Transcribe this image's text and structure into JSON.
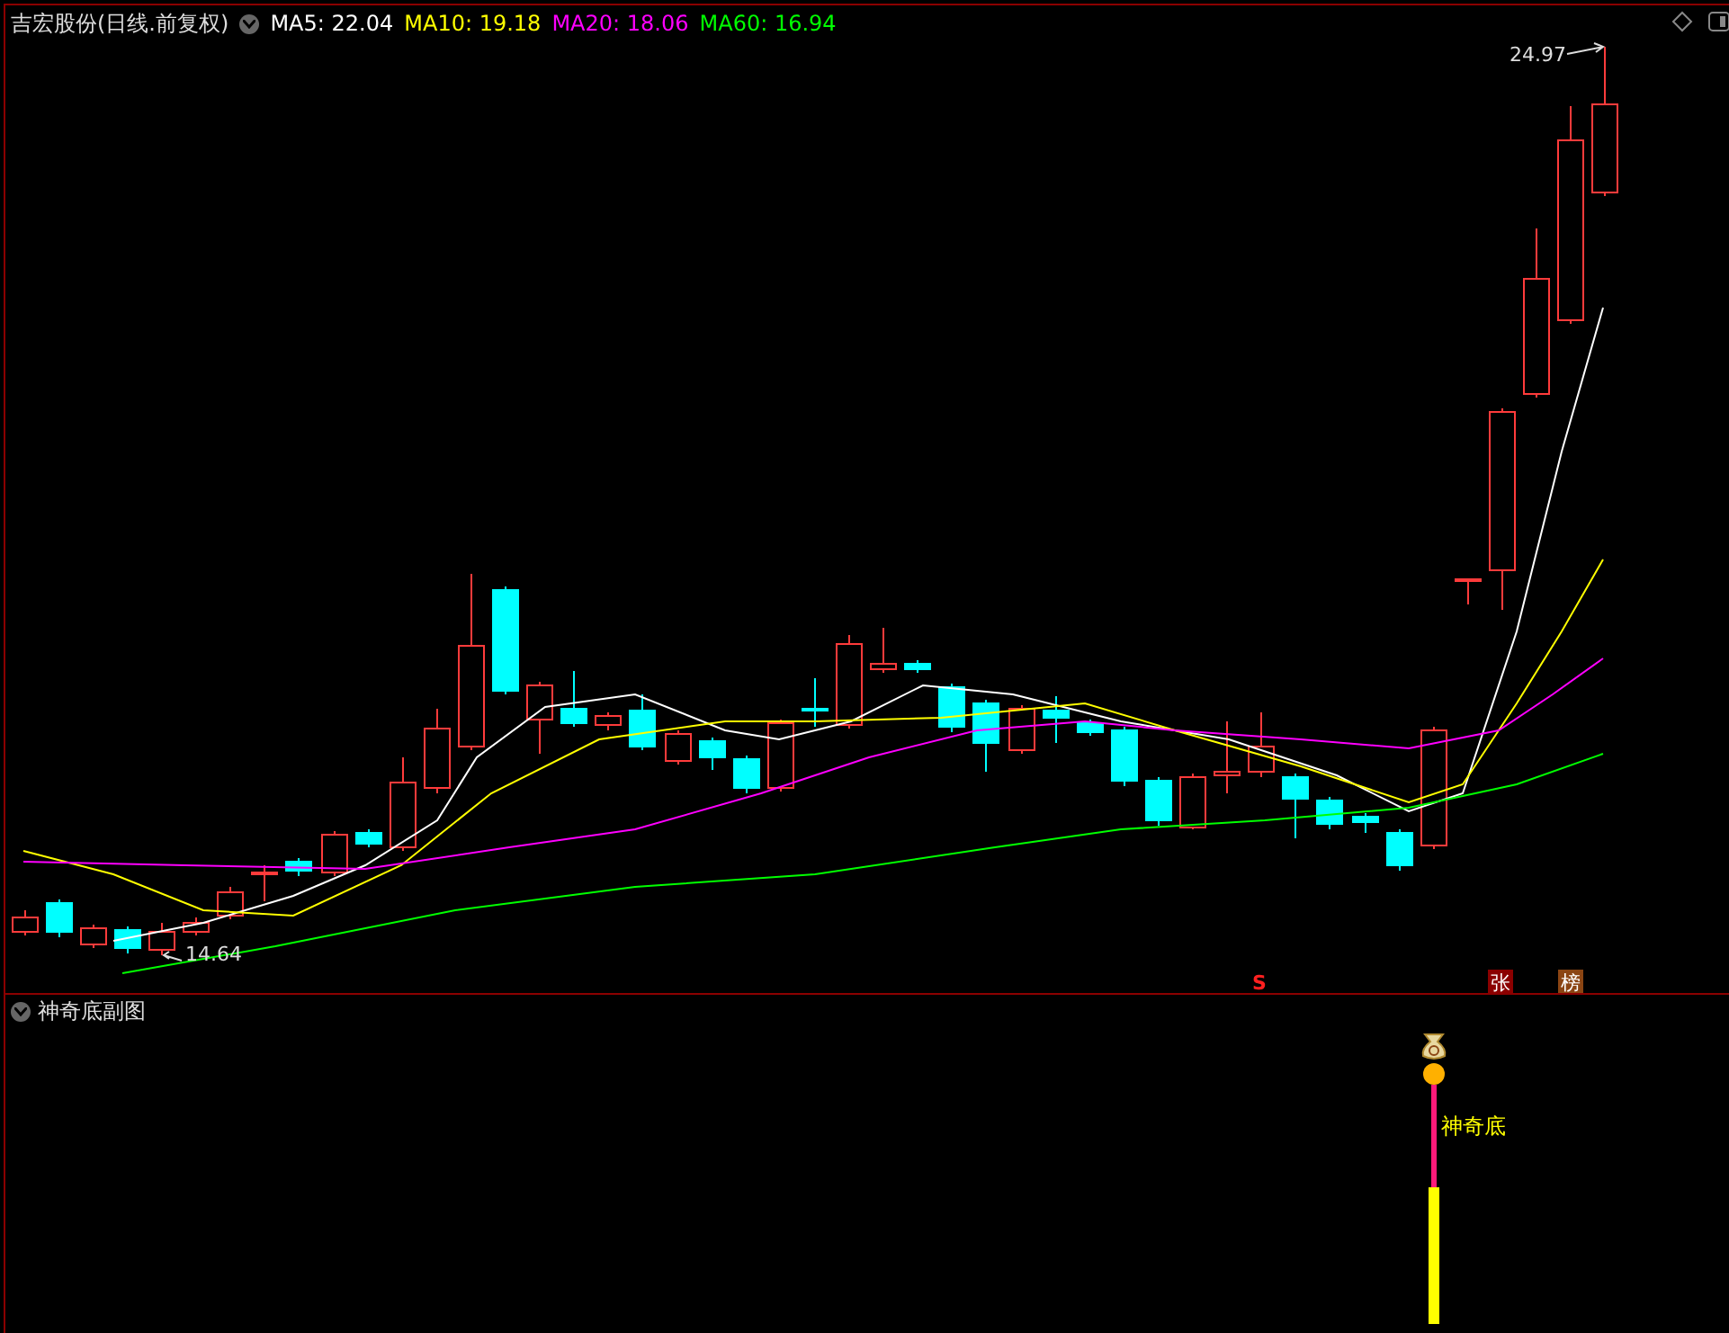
{
  "header": {
    "title": "吉宏股份(日线.前复权)",
    "ma": [
      {
        "label": "MA5:",
        "value": "22.04",
        "color": "#ffffff"
      },
      {
        "label": "MA10:",
        "value": "19.18",
        "color": "#ffff00"
      },
      {
        "label": "MA20:",
        "value": "18.06",
        "color": "#ff00ff"
      },
      {
        "label": "MA60:",
        "value": "16.94",
        "color": "#00ff00"
      }
    ]
  },
  "chart": {
    "high_label": "24.97",
    "low_label": "14.64",
    "markers": [
      {
        "kind": "arrow",
        "text": "S",
        "color": "#ff2020"
      },
      {
        "kind": "tag",
        "text": "张",
        "color": "#8b0000"
      },
      {
        "kind": "tag",
        "text": "榜",
        "color": "#8b4513"
      }
    ]
  },
  "sub_panel": {
    "title": "神奇底副图",
    "signal_label": "神奇底"
  }
}
